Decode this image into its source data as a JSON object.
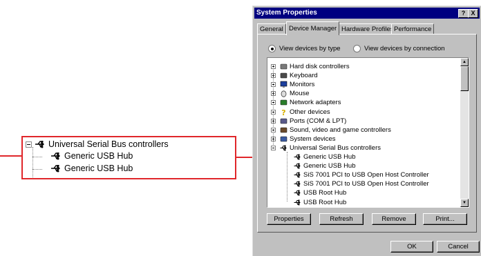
{
  "callout": {
    "parent_label": "Universal Serial Bus controllers",
    "children": [
      "Generic USB Hub",
      "Generic USB Hub"
    ]
  },
  "dialog": {
    "title": "System Properties",
    "titlebar_buttons": [
      "?",
      "X"
    ],
    "tabs": [
      {
        "label": "General",
        "active": false
      },
      {
        "label": "Device Manager",
        "active": true
      },
      {
        "label": "Hardware Profiles",
        "active": false
      },
      {
        "label": "Performance",
        "active": false
      }
    ],
    "view_by_type": "View devices by type",
    "view_by_connection": "View devices by connection",
    "tree": [
      {
        "label": "Hard disk controllers",
        "icon": "disk-icon",
        "level": 0
      },
      {
        "label": "Keyboard",
        "icon": "keyboard-icon",
        "level": 0
      },
      {
        "label": "Monitors",
        "icon": "monitor-icon",
        "level": 0
      },
      {
        "label": "Mouse",
        "icon": "mouse-icon",
        "level": 0
      },
      {
        "label": "Network adapters",
        "icon": "network-icon",
        "level": 0
      },
      {
        "label": "Other devices",
        "icon": "question-icon",
        "level": 0
      },
      {
        "label": "Ports (COM & LPT)",
        "icon": "port-icon",
        "level": 0
      },
      {
        "label": "Sound, video and game controllers",
        "icon": "sound-icon",
        "level": 0
      },
      {
        "label": "System devices",
        "icon": "system-icon",
        "level": 0
      },
      {
        "label": "Universal Serial Bus controllers",
        "icon": "usb-icon",
        "level": 0,
        "expanded": true
      },
      {
        "label": "Generic USB Hub",
        "icon": "usb-icon",
        "level": 1
      },
      {
        "label": "Generic USB Hub",
        "icon": "usb-icon",
        "level": 1
      },
      {
        "label": "SiS 7001 PCI to USB Open Host Controller",
        "icon": "usb-icon",
        "level": 1
      },
      {
        "label": "SiS 7001 PCI to USB Open Host Controller",
        "icon": "usb-icon",
        "level": 1
      },
      {
        "label": "USB Root Hub",
        "icon": "usb-icon",
        "level": 1
      },
      {
        "label": "USB Root Hub",
        "icon": "usb-icon",
        "level": 1
      }
    ],
    "buttons": {
      "properties": "Properties",
      "refresh": "Refresh",
      "remove": "Remove",
      "print": "Print...",
      "ok": "OK",
      "cancel": "Cancel"
    }
  },
  "colors": {
    "callout_border": "#e0262a",
    "titlebar": "#000080",
    "face": "#c0c0c0"
  }
}
